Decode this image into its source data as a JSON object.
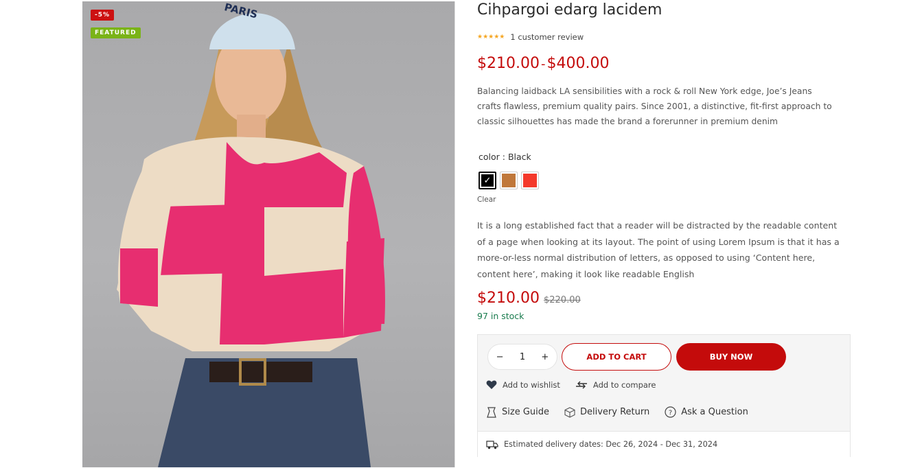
{
  "badges": {
    "sale": "-5%",
    "featured": "FEATURED"
  },
  "image": {
    "cap_text": "PARIS"
  },
  "product": {
    "title": "Cihpargoi edarg lacidem",
    "stars": "★★★★★",
    "review_text": "1 customer review",
    "price_from": "$210.00",
    "price_sep": "-",
    "price_to": "$400.00",
    "short_description": "Balancing laidback LA sensibilities with a rock & roll New York edge, Joe’s Jeans crafts flawless, premium quality pairs. Since 2001, a distinctive, fit-first approach to classic silhouettes has made the brand a forerunner in premium denim",
    "color_label": "color : Black",
    "colors": [
      {
        "name": "Black",
        "hex": "#000000",
        "selected": true
      },
      {
        "name": "Brown",
        "hex": "#c0783b",
        "selected": false
      },
      {
        "name": "Red",
        "hex": "#f4392b",
        "selected": false
      }
    ],
    "clear_label": "Clear",
    "long_description": "It is a long established fact that a reader will be distracted by the readable content of a page when looking at its layout. The point of using Lorem Ipsum is that it has a more-or-less normal distribution of letters, as opposed to using ‘Content here, content here’, making it look like readable English",
    "price_now": "$210.00",
    "price_old": "$220.00",
    "stock": "97 in stock"
  },
  "cart": {
    "qty_minus": "−",
    "qty_value": "1",
    "qty_plus": "+",
    "add_to_cart": "ADD TO CART",
    "buy_now": "BUY NOW",
    "wishlist": "Add to wishlist",
    "compare": "Add to compare",
    "size_guide": "Size Guide",
    "delivery_return": "Delivery Return",
    "ask_question": "Ask a Question",
    "delivery_estimate": "Estimated delivery dates: Dec 26, 2024 - Dec 31, 2024"
  },
  "colors": {
    "accent": "#c40b0b",
    "sale_badge": "#cc1111",
    "featured_badge": "#7ab317",
    "stock": "#177a4c",
    "star": "#f5a623"
  }
}
